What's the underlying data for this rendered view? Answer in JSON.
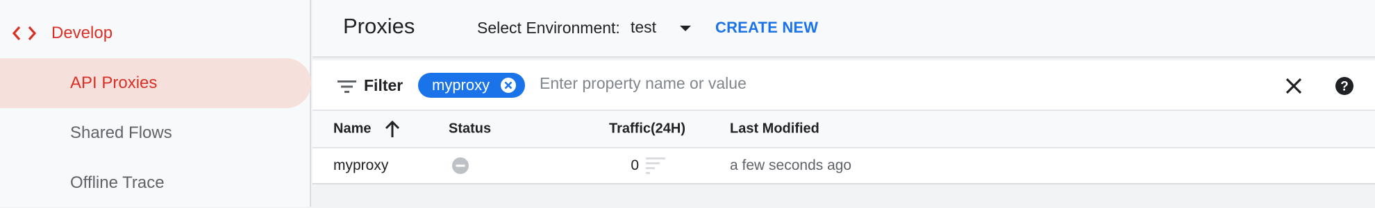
{
  "sidebar": {
    "section": {
      "label": "Develop",
      "icon": "code-icon"
    },
    "items": [
      {
        "label": "API Proxies",
        "active": true
      },
      {
        "label": "Shared Flows",
        "active": false
      },
      {
        "label": "Offline Trace",
        "active": false
      }
    ]
  },
  "header": {
    "title": "Proxies",
    "env_label": "Select Environment:",
    "env_value": "test",
    "create_new": "CREATE NEW"
  },
  "filter": {
    "label": "Filter",
    "chip": "myproxy",
    "placeholder": "Enter property name or value"
  },
  "table": {
    "columns": [
      "Name",
      "Status",
      "Traffic(24H)",
      "Last Modified"
    ],
    "sort_column": "Name",
    "sort_direction": "ascending",
    "rows": [
      {
        "name": "myproxy",
        "status": "undeployed",
        "traffic": "0",
        "last_modified": "a few seconds ago"
      }
    ]
  },
  "colors": {
    "accent_red": "#d93025",
    "accent_blue": "#1a73e8",
    "active_bg": "#f6e0dc"
  }
}
